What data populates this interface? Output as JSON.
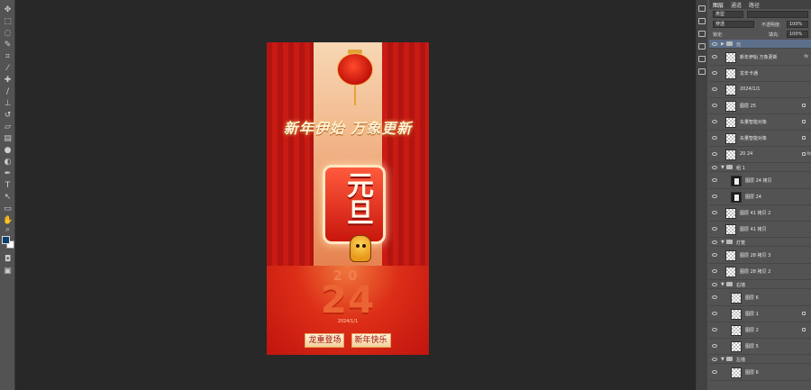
{
  "panel": {
    "tab_layers": "图层",
    "tab_channels": "通道",
    "tab_paths": "路径",
    "filter_kind": "类型",
    "blend_mode": "穿透",
    "opacity_label": "不透明度:",
    "opacity_value": "100%",
    "lock_label": "锁定:",
    "fill_label": "填充:",
    "fill_value": "100%"
  },
  "layers": [
    {
      "name": "元",
      "kind": "group",
      "selected": true
    },
    {
      "name": "新年伊始 万象更新",
      "kind": "layer",
      "thumb": "checker",
      "fx": "fx"
    },
    {
      "name": "龙年卡通",
      "kind": "layer",
      "thumb": "checker"
    },
    {
      "name": "2024/1/1",
      "kind": "layer",
      "thumb": "checker"
    },
    {
      "name": "图层 25",
      "kind": "layer",
      "thumb": "checker",
      "lock": true
    },
    {
      "name": "矢量智能对象",
      "kind": "layer",
      "thumb": "checker",
      "lock": true
    },
    {
      "name": "矢量智能对象",
      "kind": "layer",
      "thumb": "checker",
      "lock": true
    },
    {
      "name": "20 24",
      "kind": "layer",
      "thumb": "checker",
      "fx": "fx",
      "lock": true
    },
    {
      "name": "组 1",
      "kind": "group"
    },
    {
      "name": "图层 24 拷贝",
      "kind": "layer",
      "thumb": "dark",
      "indent": true
    },
    {
      "name": "图层 24",
      "kind": "layer",
      "thumb": "dark",
      "indent": true
    },
    {
      "name": "图层 41 拷贝 2",
      "kind": "layer",
      "thumb": "checker"
    },
    {
      "name": "图层 41 拷贝",
      "kind": "layer",
      "thumb": "checker"
    },
    {
      "name": "灯笼",
      "kind": "group"
    },
    {
      "name": "图层 28 拷贝 3",
      "kind": "layer",
      "thumb": "checker"
    },
    {
      "name": "图层 28 拷贝 2",
      "kind": "layer",
      "thumb": "checker"
    },
    {
      "name": "右墙",
      "kind": "group"
    },
    {
      "name": "图层 6",
      "kind": "layer",
      "thumb": "checker",
      "indent": true
    },
    {
      "name": "图层 1",
      "kind": "layer",
      "thumb": "checker",
      "indent": true,
      "lock": true
    },
    {
      "name": "图层 2",
      "kind": "layer",
      "thumb": "checker",
      "indent": true,
      "lock": true
    },
    {
      "name": "图层 5",
      "kind": "layer",
      "thumb": "checker",
      "indent": true
    },
    {
      "name": "左墙",
      "kind": "group"
    },
    {
      "name": "图层 6",
      "kind": "layer",
      "thumb": "checker",
      "indent": true
    }
  ],
  "artwork": {
    "slogan": "新年伊始  万象更新",
    "badge": "元旦",
    "year_top": "20",
    "year_bottom": "24",
    "date": "2024/1/1",
    "tag_left": "龙重登场",
    "tag_right": "新年快乐"
  },
  "tools": [
    "move-tool",
    "marquee-tool",
    "lasso-tool",
    "quick-select-tool",
    "crop-tool",
    "eyedropper-tool",
    "healing-tool",
    "brush-tool",
    "clone-stamp-tool",
    "history-brush-tool",
    "eraser-tool",
    "gradient-tool",
    "blur-tool",
    "dodge-tool",
    "pen-tool",
    "type-tool",
    "path-select-tool",
    "shape-tool",
    "hand-tool",
    "zoom-tool"
  ],
  "colors": {
    "foreground": "#0f3d6e",
    "background": "#ffffff",
    "selection": "#5c6f8a"
  }
}
